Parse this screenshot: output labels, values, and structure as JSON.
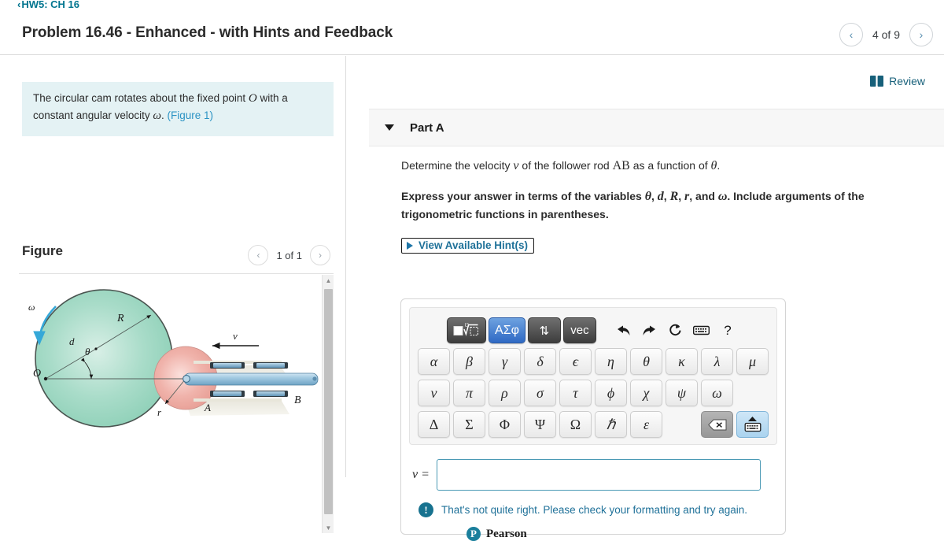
{
  "header": {
    "breadcrumb": "HW5: CH 16",
    "breadcrumb_chevron": "‹",
    "title": "Problem 16.46 - Enhanced - with Hints and Feedback",
    "prev_label": "‹",
    "next_label": "›",
    "pager_label": "4 of 9"
  },
  "left": {
    "statement_part1": "The circular cam rotates about the fixed point ",
    "statement_var_O": "O",
    "statement_part2": " with a constant angular velocity ",
    "statement_var_w": "ω",
    "statement_part3": ". ",
    "figure_link": "(Figure 1)",
    "figure_title": "Figure",
    "figure_prev": "‹",
    "figure_next": "›",
    "figure_pager_label": "1 of 1",
    "scroll_up": "▲",
    "scroll_down": "▼",
    "figure_labels": {
      "omega": "ω",
      "R": "R",
      "d": "d",
      "theta": "θ",
      "O": "O",
      "r": "r",
      "A": "A",
      "B": "B",
      "v": "v"
    }
  },
  "right": {
    "review_label": "Review",
    "part_label": "Part A",
    "question_pre": "Determine the velocity ",
    "question_v": "v",
    "question_mid": " of the follower rod ",
    "question_AB": "AB",
    "question_post": " as a function of ",
    "question_theta": "θ",
    "question_end": ".",
    "instruction_pre": "Express your answer in terms of the variables ",
    "instruction_vars": [
      "θ",
      "d",
      "R",
      "r"
    ],
    "instruction_and": ", and ",
    "instruction_omega": "ω",
    "instruction_post": ". Include arguments of the trigonometric functions in parentheses.",
    "hints_label": "View Available Hint(s)",
    "answer_label": "v =",
    "answer_value": "",
    "answer_placeholder": "",
    "feedback_icon": "!",
    "feedback_text": "That's not quite right. Please check your formatting and try again.",
    "pearson_mark": "P",
    "pearson_name": "Pearson"
  },
  "mathbar": {
    "mode_buttons": [
      {
        "name": "template-palette",
        "label": "√",
        "style": "dark",
        "selected": false
      },
      {
        "name": "greek-palette",
        "label": "ΑΣφ",
        "style": "blue",
        "selected": true
      },
      {
        "name": "arrows-palette",
        "label": "⇅",
        "style": "dark",
        "selected": false
      },
      {
        "name": "vector-palette",
        "label": "vec",
        "style": "dark",
        "selected": false
      }
    ],
    "action_icons": [
      {
        "name": "undo-icon",
        "label": "↶"
      },
      {
        "name": "redo-icon",
        "label": "↷"
      },
      {
        "name": "reset-icon",
        "label": "⟳"
      },
      {
        "name": "keyboard-icon",
        "label": "⌨"
      },
      {
        "name": "help-icon",
        "label": "?"
      }
    ],
    "greek_row1": [
      "α",
      "β",
      "γ",
      "δ",
      "ϵ",
      "η",
      "θ",
      "κ",
      "λ",
      "μ"
    ],
    "greek_row2": [
      "ν",
      "π",
      "ρ",
      "σ",
      "τ",
      "ϕ",
      "χ",
      "ψ",
      "ω"
    ],
    "greek_row3": [
      "Δ",
      "Σ",
      "Φ",
      "Ψ",
      "Ω",
      "ℏ",
      "ε"
    ],
    "backspace_label": "⌫",
    "keyboard_label": "⌨"
  },
  "colors": {
    "accent_teal": "#17607a",
    "link_blue": "#2b93c4",
    "statement_bg": "#e4f2f4",
    "selected_blue": "#2f69c4",
    "input_border": "#4b9ab5",
    "cam_green": "#8fd4bd",
    "roller_red": "#e8a8a0",
    "rod_blue": "#8fc0dd"
  }
}
